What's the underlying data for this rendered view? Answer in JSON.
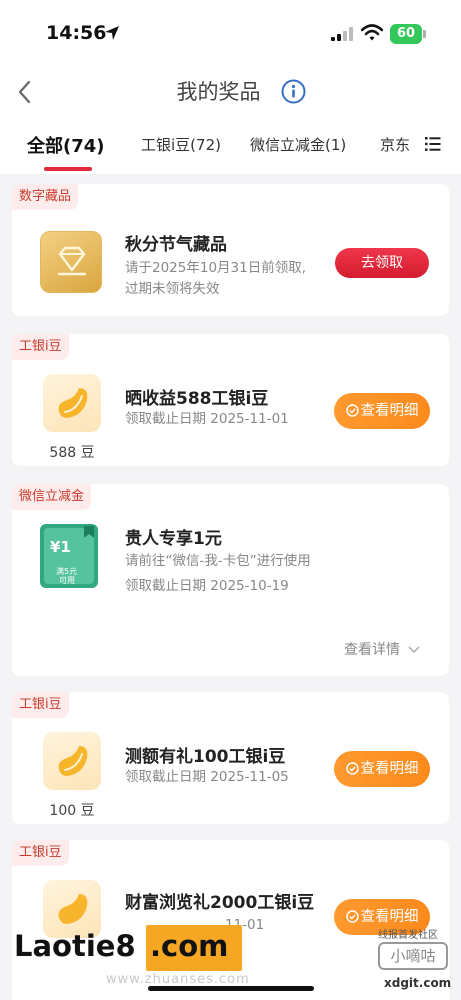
{
  "status": {
    "time": "14:56",
    "battery": "60"
  },
  "nav": {
    "title": "我的奖品"
  },
  "tabs": [
    {
      "label": "全部(74)",
      "active": true
    },
    {
      "label": "工银i豆(72)"
    },
    {
      "label": "微信立减金(1)"
    },
    {
      "label": "京东"
    }
  ],
  "cards": [
    {
      "tag": "数字藏品",
      "title": "秋分节气藏品",
      "desc1": "请于2025年10月31日前领取,",
      "desc2": "过期未领将失效",
      "button": "去领取"
    },
    {
      "tag": "工银i豆",
      "title": "晒收益588工银i豆",
      "desc1": "领取截止日期 2025-11-01",
      "qty": "588 豆",
      "button": "查看明细"
    },
    {
      "tag": "微信立减金",
      "title": "贵人专享1元",
      "desc1": "请前往“微信-我-卡包”进行使用",
      "desc2": "领取截止日期 2025-10-19",
      "coupon_amount": "¥1",
      "coupon_cond1": "满5元",
      "coupon_cond2": "可用",
      "link": "查看详情"
    },
    {
      "tag": "工银i豆",
      "title": "测额有礼100工银i豆",
      "desc1": "领取截止日期 2025-11-05",
      "qty": "100 豆",
      "button": "查看明细"
    },
    {
      "tag": "工银i豆",
      "title": "财富浏览礼2000工银i豆",
      "desc1": "11-01",
      "button": "查看明细"
    }
  ],
  "watermark": {
    "brand": "Laotie8",
    "brand_com": ".com",
    "faint": "www.zhuanses.com",
    "right_top": "线报首发社区",
    "right_box": "小嘀咕",
    "right_url": "xdgit.com"
  },
  "colors": {
    "accent_red": "#e5283a",
    "orange": "#fb8a1c",
    "tag_bg": "#fdeceb"
  }
}
